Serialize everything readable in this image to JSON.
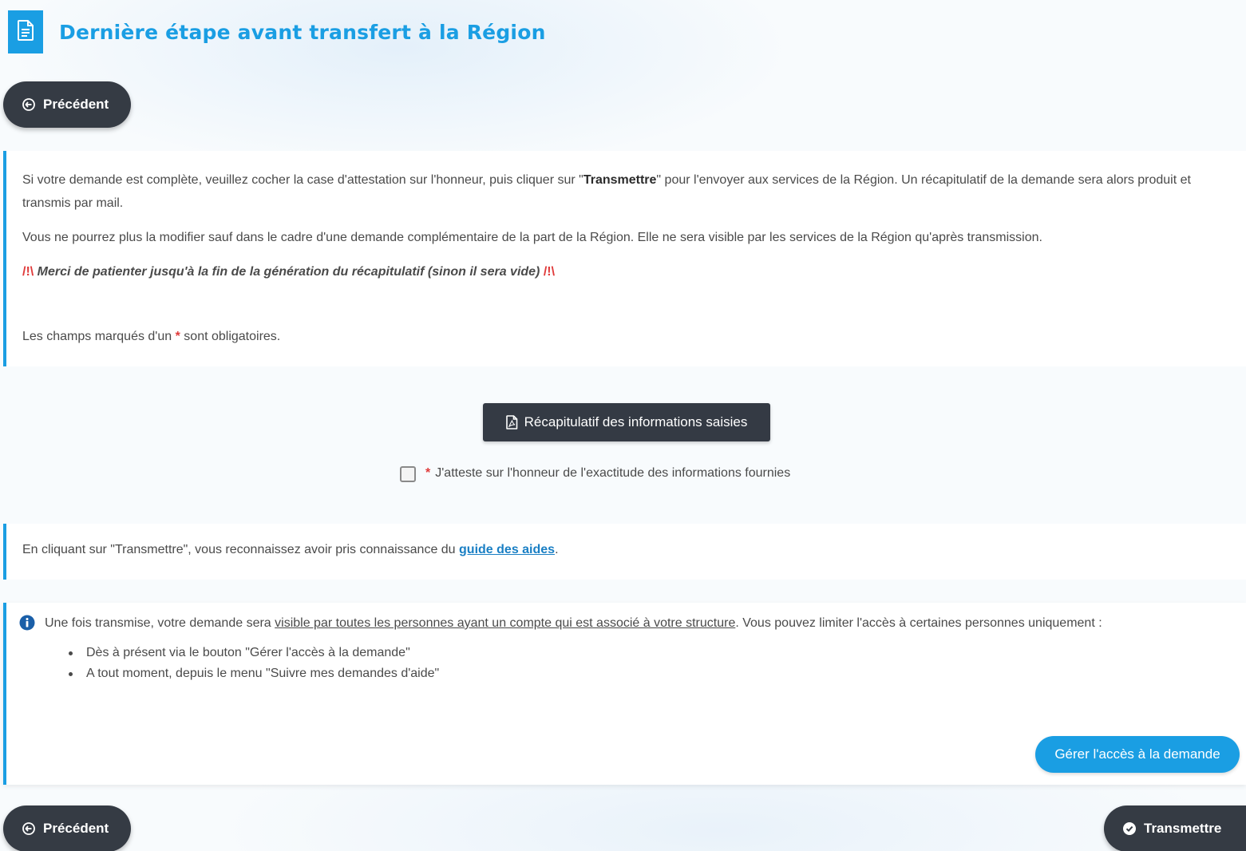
{
  "header": {
    "title": "Dernière étape avant transfert à la Région",
    "icon": "document-icon"
  },
  "nav": {
    "previous_label": "Précédent",
    "submit_label": "Transmettre"
  },
  "intro": {
    "p1_before": "Si votre demande est complète, veuillez cocher la case d'attestation sur l'honneur, puis cliquer sur \"",
    "p1_bold": "Transmettre",
    "p1_after": "\" pour l'envoyer aux services de la Région. Un récapitulatif de la demande sera alors produit et transmis par mail.",
    "p2": "Vous ne pourrez plus la modifier sauf dans le cadre d'une demande complémentaire de la part de la Région. Elle ne sera visible par les services de la Région qu'après transmission.",
    "warn_mark": "/!\\",
    "warn_text": " Merci de patienter jusqu'à la fin de la génération du récapitulatif (sinon il sera vide) ",
    "mandatory_before": "Les champs marqués d'un ",
    "mandatory_star": "*",
    "mandatory_after": " sont obligatoires."
  },
  "summary_button": {
    "label": "Récapitulatif des informations saisies"
  },
  "attestation": {
    "star": "*",
    "label": "J'atteste sur l'honneur de l'exactitude des informations fournies",
    "checked": false
  },
  "guide": {
    "before": "En cliquant sur \"Transmettre\", vous reconnaissez avoir pris connaissance du ",
    "link": "guide des aides",
    "after": "."
  },
  "info": {
    "before": "Une fois transmise, votre demande sera ",
    "underlined": "visible par toutes les personnes ayant un compte qui est associé à votre structure",
    "after": ". Vous pouvez limiter l'accès à certaines personnes uniquement :",
    "bullets": [
      "Dès à présent via le bouton \"Gérer l'accès à la demande\"",
      "A tout moment, depuis le menu \"Suivre mes demandes d'aide\""
    ],
    "manage_access_label": "Gérer l'accès à la demande"
  },
  "colors": {
    "accent": "#1a9ee3",
    "dark_button": "#353b44",
    "required": "#e03b3b"
  }
}
